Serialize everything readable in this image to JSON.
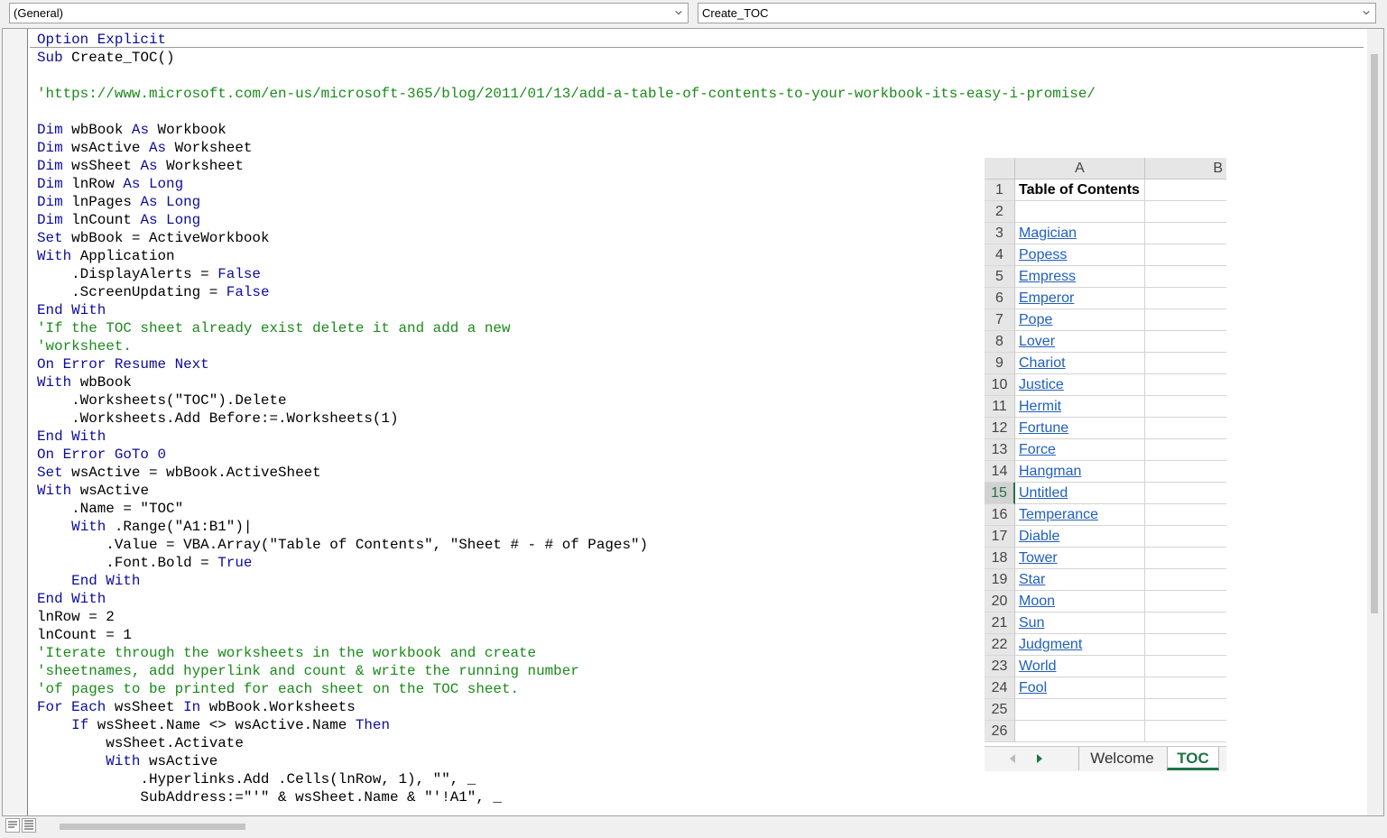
{
  "object_dropdown": {
    "value": "(General)"
  },
  "procedure_dropdown": {
    "value": "Create_TOC"
  },
  "code_lines": [
    [
      {
        "t": "Option Explicit",
        "c": "kw"
      }
    ],
    [
      {
        "t": "Sub ",
        "c": "kw"
      },
      {
        "t": "Create_TOC()"
      }
    ],
    [
      {
        "t": ""
      }
    ],
    [
      {
        "t": "'https://www.microsoft.com/en-us/microsoft-365/blog/2011/01/13/add-a-table-of-contents-to-your-workbook-its-easy-i-promise/",
        "c": "cm"
      }
    ],
    [
      {
        "t": ""
      }
    ],
    [
      {
        "t": "Dim ",
        "c": "kw"
      },
      {
        "t": "wbBook "
      },
      {
        "t": "As ",
        "c": "kw"
      },
      {
        "t": "Workbook"
      }
    ],
    [
      {
        "t": "Dim ",
        "c": "kw"
      },
      {
        "t": "wsActive "
      },
      {
        "t": "As ",
        "c": "kw"
      },
      {
        "t": "Worksheet"
      }
    ],
    [
      {
        "t": "Dim ",
        "c": "kw"
      },
      {
        "t": "wsSheet "
      },
      {
        "t": "As ",
        "c": "kw"
      },
      {
        "t": "Worksheet"
      }
    ],
    [
      {
        "t": "Dim ",
        "c": "kw"
      },
      {
        "t": "lnRow "
      },
      {
        "t": "As Long",
        "c": "kw"
      }
    ],
    [
      {
        "t": "Dim ",
        "c": "kw"
      },
      {
        "t": "lnPages "
      },
      {
        "t": "As Long",
        "c": "kw"
      }
    ],
    [
      {
        "t": "Dim ",
        "c": "kw"
      },
      {
        "t": "lnCount "
      },
      {
        "t": "As Long",
        "c": "kw"
      }
    ],
    [
      {
        "t": "Set ",
        "c": "kw"
      },
      {
        "t": "wbBook = ActiveWorkbook"
      }
    ],
    [
      {
        "t": "With ",
        "c": "kw"
      },
      {
        "t": "Application"
      }
    ],
    [
      {
        "t": "    .DisplayAlerts = "
      },
      {
        "t": "False",
        "c": "kw"
      }
    ],
    [
      {
        "t": "    .ScreenUpdating = "
      },
      {
        "t": "False",
        "c": "kw"
      }
    ],
    [
      {
        "t": "End With",
        "c": "kw"
      }
    ],
    [
      {
        "t": "'If the TOC sheet already exist delete it and add a new",
        "c": "cm"
      }
    ],
    [
      {
        "t": "'worksheet.",
        "c": "cm"
      }
    ],
    [
      {
        "t": "On Error Resume Next",
        "c": "kw"
      }
    ],
    [
      {
        "t": "With ",
        "c": "kw"
      },
      {
        "t": "wbBook"
      }
    ],
    [
      {
        "t": "    .Worksheets(\"TOC\").Delete"
      }
    ],
    [
      {
        "t": "    .Worksheets.Add Before:=.Worksheets(1)"
      }
    ],
    [
      {
        "t": "End With",
        "c": "kw"
      }
    ],
    [
      {
        "t": "On Error GoTo 0",
        "c": "kw"
      }
    ],
    [
      {
        "t": "Set ",
        "c": "kw"
      },
      {
        "t": "wsActive = wbBook.ActiveSheet"
      }
    ],
    [
      {
        "t": "With ",
        "c": "kw"
      },
      {
        "t": "wsActive"
      }
    ],
    [
      {
        "t": "    .Name = \"TOC\""
      }
    ],
    [
      {
        "t": "    "
      },
      {
        "t": "With ",
        "c": "kw"
      },
      {
        "t": ".Range(\"A1:B1\")|"
      }
    ],
    [
      {
        "t": "        .Value = VBA.Array(\"Table of Contents\", \"Sheet # - # of Pages\")"
      }
    ],
    [
      {
        "t": "        .Font.Bold = "
      },
      {
        "t": "True",
        "c": "kw"
      }
    ],
    [
      {
        "t": "    "
      },
      {
        "t": "End With",
        "c": "kw"
      }
    ],
    [
      {
        "t": "End With",
        "c": "kw"
      }
    ],
    [
      {
        "t": "lnRow = 2"
      }
    ],
    [
      {
        "t": "lnCount = 1"
      }
    ],
    [
      {
        "t": "'Iterate through the worksheets in the workbook and create",
        "c": "cm"
      }
    ],
    [
      {
        "t": "'sheetnames, add hyperlink and count & write the running number",
        "c": "cm"
      }
    ],
    [
      {
        "t": "'of pages to be printed for each sheet on the TOC sheet.",
        "c": "cm"
      }
    ],
    [
      {
        "t": "For Each ",
        "c": "kw"
      },
      {
        "t": "wsSheet "
      },
      {
        "t": "In ",
        "c": "kw"
      },
      {
        "t": "wbBook.Worksheets"
      }
    ],
    [
      {
        "t": "    "
      },
      {
        "t": "If ",
        "c": "kw"
      },
      {
        "t": "wsSheet.Name <> wsActive.Name "
      },
      {
        "t": "Then",
        "c": "kw"
      }
    ],
    [
      {
        "t": "        wsSheet.Activate"
      }
    ],
    [
      {
        "t": "        "
      },
      {
        "t": "With ",
        "c": "kw"
      },
      {
        "t": "wsActive"
      }
    ],
    [
      {
        "t": "            .Hyperlinks.Add .Cells(lnRow, 1), \"\", _"
      }
    ],
    [
      {
        "t": "            SubAddress:=\"'\" & wsSheet.Name & \"'!A1\", _"
      }
    ]
  ],
  "sheet": {
    "columns": [
      "A",
      "B"
    ],
    "rows": [
      {
        "n": "1",
        "a": "Table of Contents",
        "style": "bold"
      },
      {
        "n": "2",
        "a": "",
        "style": ""
      },
      {
        "n": "3",
        "a": "Magician",
        "style": "link"
      },
      {
        "n": "4",
        "a": "Popess",
        "style": "link"
      },
      {
        "n": "5",
        "a": "Empress",
        "style": "link"
      },
      {
        "n": "6",
        "a": "Emperor",
        "style": "link"
      },
      {
        "n": "7",
        "a": "Pope",
        "style": "link"
      },
      {
        "n": "8",
        "a": "Lover",
        "style": "link"
      },
      {
        "n": "9",
        "a": "Chariot",
        "style": "link"
      },
      {
        "n": "10",
        "a": "Justice",
        "style": "link"
      },
      {
        "n": "11",
        "a": "Hermit",
        "style": "link"
      },
      {
        "n": "12",
        "a": "Fortune",
        "style": "link"
      },
      {
        "n": "13",
        "a": "Force",
        "style": "link"
      },
      {
        "n": "14",
        "a": "Hangman",
        "style": "link"
      },
      {
        "n": "15",
        "a": "Untitled",
        "style": "link"
      },
      {
        "n": "16",
        "a": "Temperance",
        "style": "link"
      },
      {
        "n": "17",
        "a": "Diable",
        "style": "link"
      },
      {
        "n": "18",
        "a": "Tower",
        "style": "link"
      },
      {
        "n": "19",
        "a": "Star",
        "style": "link"
      },
      {
        "n": "20",
        "a": "Moon",
        "style": "link"
      },
      {
        "n": "21",
        "a": "Sun",
        "style": "link"
      },
      {
        "n": "22",
        "a": "Judgment",
        "style": "link"
      },
      {
        "n": "23",
        "a": "World",
        "style": "link"
      },
      {
        "n": "24",
        "a": "Fool",
        "style": "link"
      },
      {
        "n": "25",
        "a": "",
        "style": ""
      },
      {
        "n": "26",
        "a": "",
        "style": ""
      }
    ],
    "selected_row": "15",
    "tabs": [
      {
        "label": "Welcome",
        "active": false
      },
      {
        "label": "TOC",
        "active": true
      }
    ]
  },
  "colors": {
    "keyword": "#0c0c9c",
    "comment": "#1a8a1a",
    "link": "#1f5fbf",
    "excel_green": "#217346"
  }
}
